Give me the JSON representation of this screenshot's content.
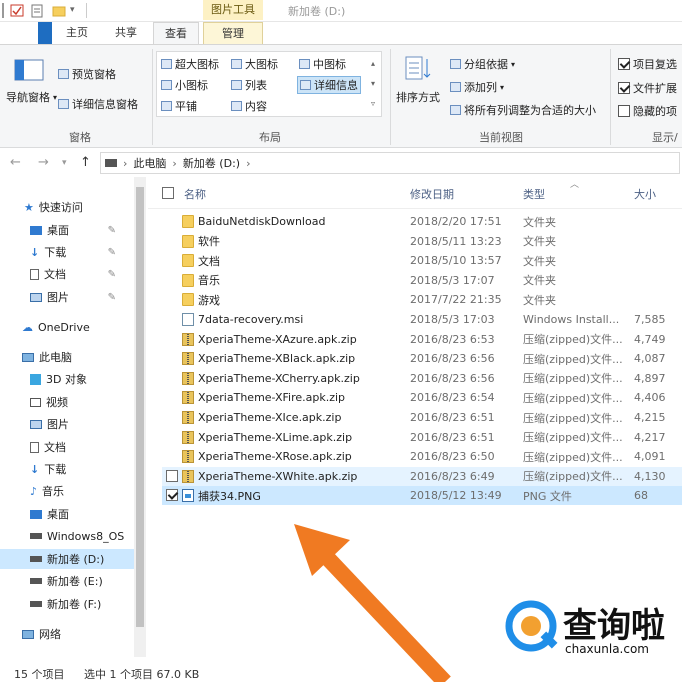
{
  "window": {
    "title": "新加卷 (D:)",
    "contextual_tab_group": "图片工具"
  },
  "tabs": {
    "home": "主页",
    "share": "共享",
    "view": "查看",
    "manage": "管理"
  },
  "ribbon": {
    "panes": {
      "nav_pane": "导航窗格",
      "preview_pane": "预览窗格",
      "details_pane": "详细信息窗格",
      "group_label": "窗格"
    },
    "layout": {
      "extra_large": "超大图标",
      "large": "大图标",
      "medium": "中图标",
      "small": "小图标",
      "list": "列表",
      "details": "详细信息",
      "tiles": "平铺",
      "content": "内容",
      "group_label": "布局"
    },
    "current_view": {
      "sort_by": "排序方式",
      "group_by": "分组依据",
      "add_columns": "添加列",
      "size_all_columns": "将所有列调整为合适的大小",
      "group_label": "当前视图"
    },
    "show_hide": {
      "item_checkboxes": "项目复选",
      "file_extensions": "文件扩展",
      "hidden_items": "隐藏的项",
      "group_label": "显示/"
    }
  },
  "address": {
    "crumb1": "此电脑",
    "crumb2": "新加卷 (D:)"
  },
  "nav": {
    "quick_access": "快速访问",
    "desktop": "桌面",
    "downloads": "下载",
    "documents": "文档",
    "pictures": "图片",
    "onedrive": "OneDrive",
    "this_pc": "此电脑",
    "objects3d": "3D 对象",
    "videos": "视频",
    "pictures2": "图片",
    "documents2": "文档",
    "downloads2": "下载",
    "music": "音乐",
    "desktop2": "桌面",
    "drive_c": "Windows8_OS",
    "drive_d": "新加卷 (D:)",
    "drive_e": "新加卷 (E:)",
    "drive_f": "新加卷 (F:)",
    "network": "网络"
  },
  "columns": {
    "name": "名称",
    "date": "修改日期",
    "type": "类型",
    "size": "大小"
  },
  "files": [
    {
      "name": "BaiduNetdiskDownload",
      "date": "2018/2/20 17:51",
      "type": "文件夹",
      "size": "",
      "icon": "folder"
    },
    {
      "name": "软件",
      "date": "2018/5/11 13:23",
      "type": "文件夹",
      "size": "",
      "icon": "folder"
    },
    {
      "name": "文档",
      "date": "2018/5/10 13:57",
      "type": "文件夹",
      "size": "",
      "icon": "folder"
    },
    {
      "name": "音乐",
      "date": "2018/5/3 17:07",
      "type": "文件夹",
      "size": "",
      "icon": "folder"
    },
    {
      "name": "游戏",
      "date": "2017/7/22 21:35",
      "type": "文件夹",
      "size": "",
      "icon": "folder"
    },
    {
      "name": "7data-recovery.msi",
      "date": "2018/5/3 17:03",
      "type": "Windows Install...",
      "size": "7,585",
      "icon": "msi"
    },
    {
      "name": "XperiaTheme-XAzure.apk.zip",
      "date": "2016/8/23 6:53",
      "type": "压缩(zipped)文件...",
      "size": "4,749",
      "icon": "zip"
    },
    {
      "name": "XperiaTheme-XBlack.apk.zip",
      "date": "2016/8/23 6:56",
      "type": "压缩(zipped)文件...",
      "size": "4,087",
      "icon": "zip"
    },
    {
      "name": "XperiaTheme-XCherry.apk.zip",
      "date": "2016/8/23 6:56",
      "type": "压缩(zipped)文件...",
      "size": "4,897",
      "icon": "zip"
    },
    {
      "name": "XperiaTheme-XFire.apk.zip",
      "date": "2016/8/23 6:54",
      "type": "压缩(zipped)文件...",
      "size": "4,406",
      "icon": "zip"
    },
    {
      "name": "XperiaTheme-XIce.apk.zip",
      "date": "2016/8/23 6:51",
      "type": "压缩(zipped)文件...",
      "size": "4,215",
      "icon": "zip"
    },
    {
      "name": "XperiaTheme-XLime.apk.zip",
      "date": "2016/8/23 6:51",
      "type": "压缩(zipped)文件...",
      "size": "4,217",
      "icon": "zip"
    },
    {
      "name": "XperiaTheme-XRose.apk.zip",
      "date": "2016/8/23 6:50",
      "type": "压缩(zipped)文件...",
      "size": "4,091",
      "icon": "zip"
    },
    {
      "name": "XperiaTheme-XWhite.apk.zip",
      "date": "2016/8/23 6:49",
      "type": "压缩(zipped)文件...",
      "size": "4,130",
      "icon": "zip"
    },
    {
      "name": "捕获34.PNG",
      "date": "2018/5/12 13:49",
      "type": "PNG 文件",
      "size": "68",
      "icon": "png"
    }
  ],
  "status": {
    "count": "15 个项目",
    "selected": "选中 1 个项目  67.0 KB"
  },
  "watermark": {
    "brand": "查询啦",
    "url": "chaxunla.com"
  },
  "colors": {
    "accent": "#1e6dc1",
    "selection": "#cce8ff",
    "arrow": "#f07a22",
    "watermark_blue": "#1f8ee8"
  }
}
